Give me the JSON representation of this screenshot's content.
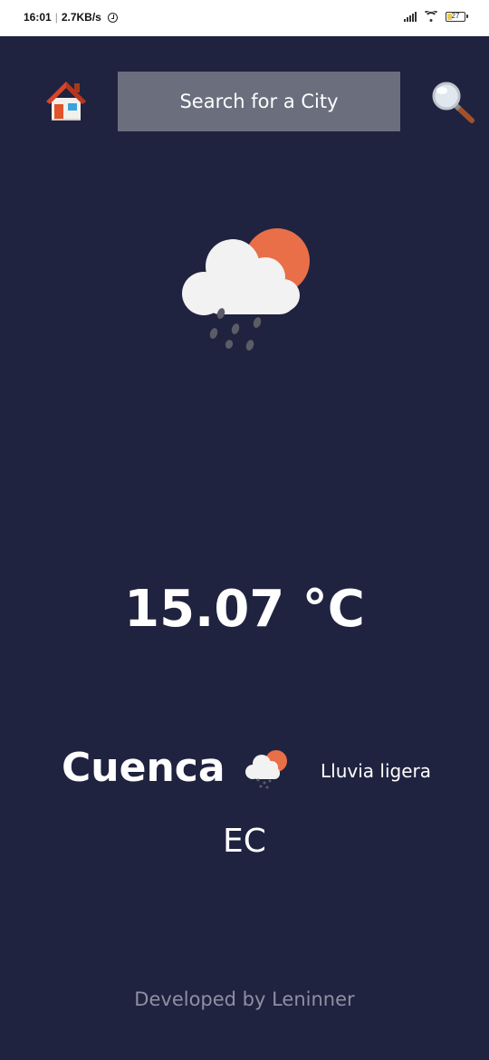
{
  "status_bar": {
    "time": "16:01",
    "speed": "2.7KB/s",
    "battery": "27"
  },
  "header": {
    "search_placeholder": "Search for a City",
    "home_icon": "house-icon",
    "search_icon": "magnifying-glass-icon"
  },
  "weather": {
    "icon": "sun-behind-rain-cloud-icon",
    "temperature": "15.07 °C",
    "city": "Cuenca",
    "description": "Lluvia ligera",
    "country": "EC"
  },
  "footer": {
    "credit": "Developed by Leninner"
  },
  "colors": {
    "background": "#1f2340",
    "search_box": "#6b6e7d",
    "footer_text": "#8d90a3",
    "sun": "#e86f48"
  }
}
